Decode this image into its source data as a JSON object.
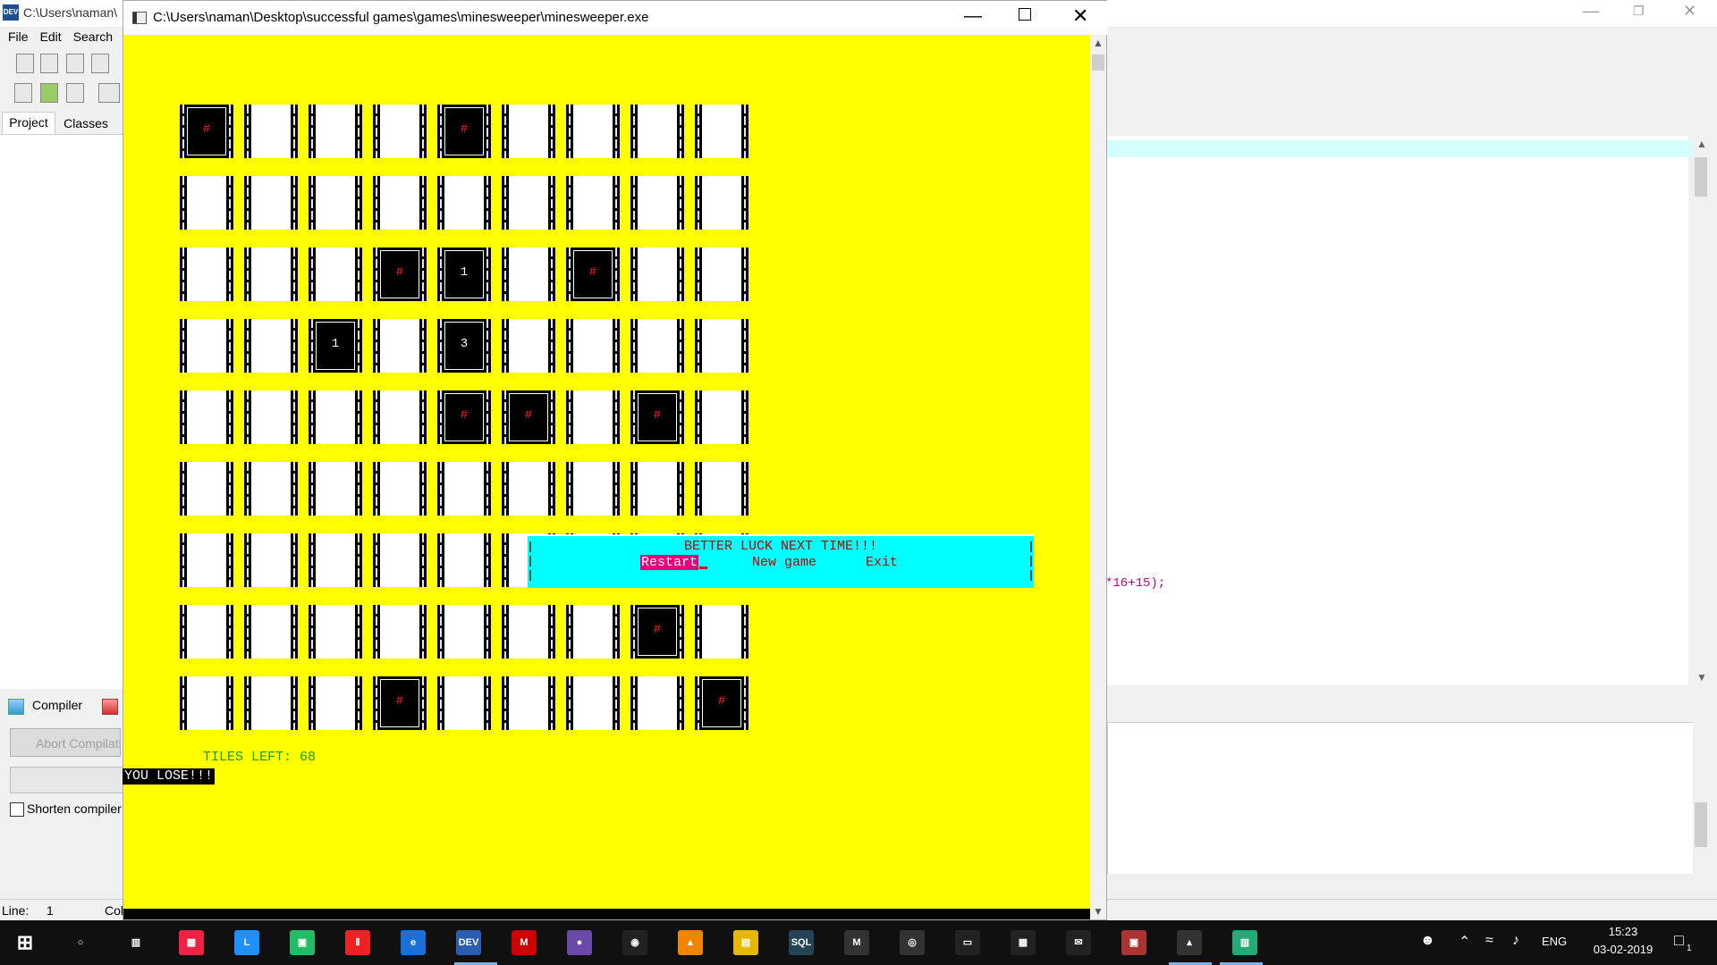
{
  "ide": {
    "title": "C:\\Users\\naman\\",
    "logo": "DEV",
    "menu": [
      "File",
      "Edit",
      "Search"
    ],
    "tabs": [
      "Project",
      "Classes"
    ],
    "code_fragment": "*16+15);",
    "compiler_tab": "Compiler",
    "abort_button": "Abort Compilation",
    "shorten_label": "Shorten compiler paths",
    "status_line_label": "Line:",
    "status_line_value": "1",
    "status_col_label": "Col"
  },
  "console": {
    "title": "C:\\Users\\naman\\Desktop\\successful games\\games\\minesweeper\\minesweeper.exe",
    "minimize": "—",
    "close": "✕"
  },
  "board": {
    "rows": 9,
    "cols": 9,
    "mine_glyph": "#",
    "cells": [
      [
        "mine",
        "",
        "",
        "",
        "mine",
        "",
        "",
        "",
        ""
      ],
      [
        "",
        "",
        "",
        "",
        "",
        "",
        "",
        "",
        ""
      ],
      [
        "",
        "",
        "",
        "mine",
        "1",
        "",
        "mine",
        "",
        ""
      ],
      [
        "",
        "",
        "1",
        "",
        "3",
        "",
        "",
        "",
        ""
      ],
      [
        "",
        "",
        "",
        "",
        "mine",
        "mine",
        "",
        "mine",
        ""
      ],
      [
        "",
        "",
        "",
        "",
        "",
        "",
        "",
        "",
        ""
      ],
      [
        "",
        "",
        "",
        "",
        "",
        "",
        "",
        "",
        ""
      ],
      [
        "",
        "",
        "",
        "",
        "",
        "",
        "",
        "mine",
        ""
      ],
      [
        "",
        "",
        "",
        "mine",
        "",
        "",
        "",
        "",
        "mine"
      ]
    ]
  },
  "status": {
    "tiles_left": "TILES LEFT: 68",
    "result": "YOU  LOSE!!!"
  },
  "dialog": {
    "title": "BETTER LUCK NEXT TIME!!!",
    "restart": "Restart",
    "new_game": "New game",
    "exit": "Exit",
    "selected": "Restart"
  },
  "taskbar": {
    "time": "15:23",
    "date": "03-02-2019",
    "language": "ENG",
    "notification_count": "1",
    "pinned_icons": [
      "start-icon",
      "cortana-icon",
      "task-view-icon",
      "tiles-app-icon",
      "l-app-icon",
      "store-icon",
      "red-app-icon",
      "edge-icon",
      "devcpp-icon",
      "mcafee-icon",
      "eclipse-icon",
      "camera-icon",
      "vlc-icon",
      "file-explorer-icon",
      "mysql-icon",
      "m-app-icon",
      "groove-icon",
      "cmd-icon",
      "calculator-icon",
      "mail-icon",
      "office-icon",
      "photos-icon",
      "console-app-icon"
    ]
  }
}
